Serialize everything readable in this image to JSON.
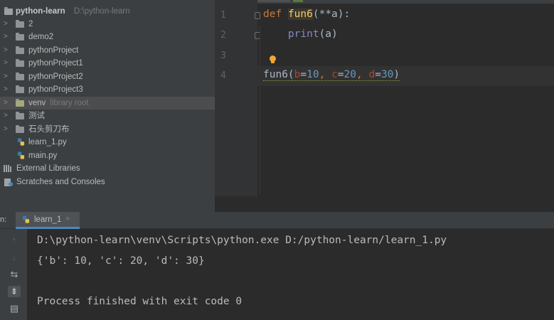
{
  "project_tree": {
    "root": {
      "name": "python-learn",
      "path": "D:\\python-learn"
    },
    "items": [
      {
        "label": "2",
        "type": "folder"
      },
      {
        "label": "demo2",
        "type": "folder"
      },
      {
        "label": "pythonProject",
        "type": "folder"
      },
      {
        "label": "pythonProject1",
        "type": "folder"
      },
      {
        "label": "pythonProject2",
        "type": "folder"
      },
      {
        "label": "pythonProject3",
        "type": "folder"
      },
      {
        "label": "venv",
        "note": "library root",
        "type": "folder",
        "selected": true
      },
      {
        "label": "测试",
        "type": "folder"
      },
      {
        "label": "石头剪刀布",
        "type": "folder"
      },
      {
        "label": "learn_1.py",
        "type": "python-file"
      },
      {
        "label": "main.py",
        "type": "python-file"
      }
    ],
    "external_libraries": "External Libraries",
    "scratches": "Scratches and Consoles"
  },
  "editor": {
    "line_numbers": [
      "1",
      "2",
      "3",
      "4"
    ],
    "line1": {
      "kw": "def",
      "fn": "fun6",
      "args": "(**a):"
    },
    "line2": {
      "indent": "    ",
      "builtin": "print",
      "args": "(a)"
    },
    "line4": {
      "fn": "fun6",
      "open": "(",
      "p1": "b",
      "eq1": "=",
      "v1": "10",
      "sep1": ", ",
      "p2": "c",
      "eq2": "=",
      "v2": "20",
      "sep2": ", ",
      "p3": "d",
      "eq3": "=",
      "v3": "30",
      "close": ")"
    }
  },
  "run_panel": {
    "header_label": "n:",
    "tab_label": "learn_1",
    "close_glyph": "×",
    "console_lines": [
      "D:\\python-learn\\venv\\Scripts\\python.exe D:/python-learn/learn_1.py",
      "{'b': 10, 'c': 20, 'd': 30}",
      "",
      "Process finished with exit code 0"
    ],
    "tools": [
      {
        "icon": "arrow-up-icon",
        "glyph": "↑"
      },
      {
        "icon": "arrow-down-icon",
        "glyph": "↓"
      },
      {
        "icon": "soft-wrap-icon",
        "glyph": "⇆"
      },
      {
        "icon": "scroll-to-end-icon",
        "glyph": "⇟"
      },
      {
        "icon": "print-icon",
        "glyph": "▤"
      }
    ]
  },
  "colors": {
    "editor_bg": "#2b2b2b",
    "panel_bg": "#3c3f41",
    "keyword": "#cc7832",
    "function": "#ffc66d",
    "number": "#6897bb",
    "builtin": "#8888c6",
    "param": "#aa4926"
  }
}
